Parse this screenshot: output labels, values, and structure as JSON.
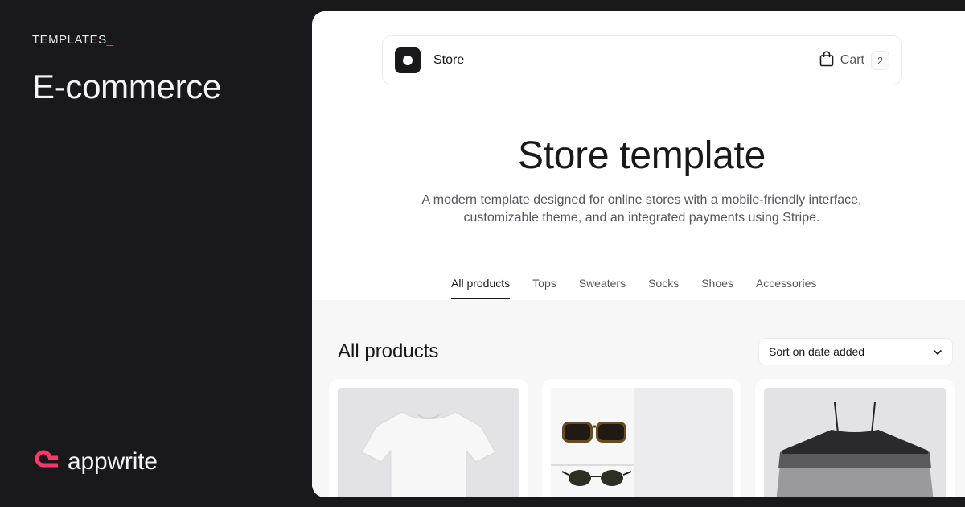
{
  "left": {
    "label": "TEMPLATES",
    "cursor": "_",
    "title": "E-commerce",
    "brand": "appwrite",
    "brand_color": "#fd366e"
  },
  "navbar": {
    "store_name": "Store",
    "cart_label": "Cart",
    "cart_count": "2",
    "cart_icon": "shopping-bag-icon"
  },
  "hero": {
    "title": "Store template",
    "description": "A modern template designed for online stores with a mobile-friendly interface, customizable theme, and an integrated payments using Stripe."
  },
  "tabs": [
    {
      "label": "All products",
      "active": true
    },
    {
      "label": "Tops",
      "active": false
    },
    {
      "label": "Sweaters",
      "active": false
    },
    {
      "label": "Socks",
      "active": false
    },
    {
      "label": "Shoes",
      "active": false
    },
    {
      "label": "Accessories",
      "active": false
    }
  ],
  "products_section": {
    "title": "All products",
    "sort_value": "Sort on date added"
  },
  "products": [
    {
      "image": "white-tshirt"
    },
    {
      "image": "sunglasses"
    },
    {
      "image": "tank-tops"
    }
  ]
}
